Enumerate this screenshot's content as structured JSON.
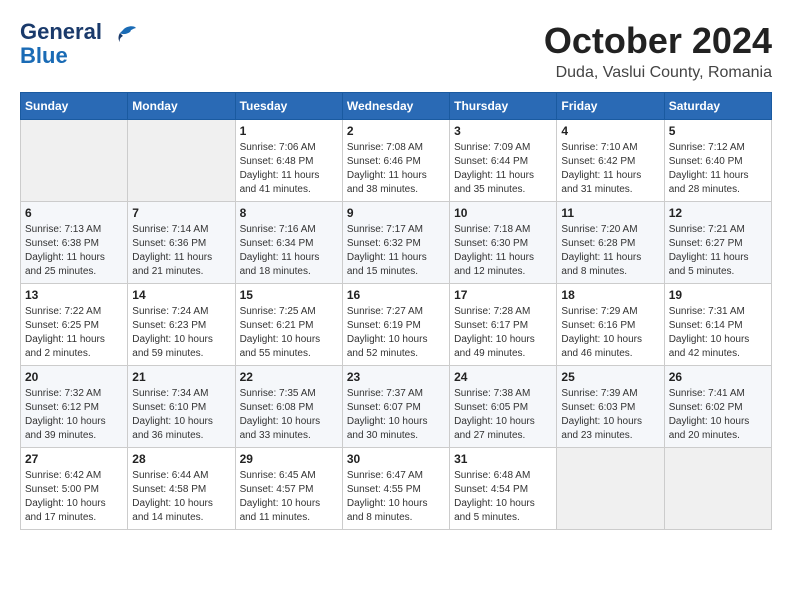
{
  "logo": {
    "line1": "General",
    "line2": "Blue"
  },
  "header": {
    "month": "October 2024",
    "location": "Duda, Vaslui County, Romania"
  },
  "weekdays": [
    "Sunday",
    "Monday",
    "Tuesday",
    "Wednesday",
    "Thursday",
    "Friday",
    "Saturday"
  ],
  "weeks": [
    [
      {
        "day": "",
        "info": ""
      },
      {
        "day": "",
        "info": ""
      },
      {
        "day": "1",
        "info": "Sunrise: 7:06 AM\nSunset: 6:48 PM\nDaylight: 11 hours and 41 minutes."
      },
      {
        "day": "2",
        "info": "Sunrise: 7:08 AM\nSunset: 6:46 PM\nDaylight: 11 hours and 38 minutes."
      },
      {
        "day": "3",
        "info": "Sunrise: 7:09 AM\nSunset: 6:44 PM\nDaylight: 11 hours and 35 minutes."
      },
      {
        "day": "4",
        "info": "Sunrise: 7:10 AM\nSunset: 6:42 PM\nDaylight: 11 hours and 31 minutes."
      },
      {
        "day": "5",
        "info": "Sunrise: 7:12 AM\nSunset: 6:40 PM\nDaylight: 11 hours and 28 minutes."
      }
    ],
    [
      {
        "day": "6",
        "info": "Sunrise: 7:13 AM\nSunset: 6:38 PM\nDaylight: 11 hours and 25 minutes."
      },
      {
        "day": "7",
        "info": "Sunrise: 7:14 AM\nSunset: 6:36 PM\nDaylight: 11 hours and 21 minutes."
      },
      {
        "day": "8",
        "info": "Sunrise: 7:16 AM\nSunset: 6:34 PM\nDaylight: 11 hours and 18 minutes."
      },
      {
        "day": "9",
        "info": "Sunrise: 7:17 AM\nSunset: 6:32 PM\nDaylight: 11 hours and 15 minutes."
      },
      {
        "day": "10",
        "info": "Sunrise: 7:18 AM\nSunset: 6:30 PM\nDaylight: 11 hours and 12 minutes."
      },
      {
        "day": "11",
        "info": "Sunrise: 7:20 AM\nSunset: 6:28 PM\nDaylight: 11 hours and 8 minutes."
      },
      {
        "day": "12",
        "info": "Sunrise: 7:21 AM\nSunset: 6:27 PM\nDaylight: 11 hours and 5 minutes."
      }
    ],
    [
      {
        "day": "13",
        "info": "Sunrise: 7:22 AM\nSunset: 6:25 PM\nDaylight: 11 hours and 2 minutes."
      },
      {
        "day": "14",
        "info": "Sunrise: 7:24 AM\nSunset: 6:23 PM\nDaylight: 10 hours and 59 minutes."
      },
      {
        "day": "15",
        "info": "Sunrise: 7:25 AM\nSunset: 6:21 PM\nDaylight: 10 hours and 55 minutes."
      },
      {
        "day": "16",
        "info": "Sunrise: 7:27 AM\nSunset: 6:19 PM\nDaylight: 10 hours and 52 minutes."
      },
      {
        "day": "17",
        "info": "Sunrise: 7:28 AM\nSunset: 6:17 PM\nDaylight: 10 hours and 49 minutes."
      },
      {
        "day": "18",
        "info": "Sunrise: 7:29 AM\nSunset: 6:16 PM\nDaylight: 10 hours and 46 minutes."
      },
      {
        "day": "19",
        "info": "Sunrise: 7:31 AM\nSunset: 6:14 PM\nDaylight: 10 hours and 42 minutes."
      }
    ],
    [
      {
        "day": "20",
        "info": "Sunrise: 7:32 AM\nSunset: 6:12 PM\nDaylight: 10 hours and 39 minutes."
      },
      {
        "day": "21",
        "info": "Sunrise: 7:34 AM\nSunset: 6:10 PM\nDaylight: 10 hours and 36 minutes."
      },
      {
        "day": "22",
        "info": "Sunrise: 7:35 AM\nSunset: 6:08 PM\nDaylight: 10 hours and 33 minutes."
      },
      {
        "day": "23",
        "info": "Sunrise: 7:37 AM\nSunset: 6:07 PM\nDaylight: 10 hours and 30 minutes."
      },
      {
        "day": "24",
        "info": "Sunrise: 7:38 AM\nSunset: 6:05 PM\nDaylight: 10 hours and 27 minutes."
      },
      {
        "day": "25",
        "info": "Sunrise: 7:39 AM\nSunset: 6:03 PM\nDaylight: 10 hours and 23 minutes."
      },
      {
        "day": "26",
        "info": "Sunrise: 7:41 AM\nSunset: 6:02 PM\nDaylight: 10 hours and 20 minutes."
      }
    ],
    [
      {
        "day": "27",
        "info": "Sunrise: 6:42 AM\nSunset: 5:00 PM\nDaylight: 10 hours and 17 minutes."
      },
      {
        "day": "28",
        "info": "Sunrise: 6:44 AM\nSunset: 4:58 PM\nDaylight: 10 hours and 14 minutes."
      },
      {
        "day": "29",
        "info": "Sunrise: 6:45 AM\nSunset: 4:57 PM\nDaylight: 10 hours and 11 minutes."
      },
      {
        "day": "30",
        "info": "Sunrise: 6:47 AM\nSunset: 4:55 PM\nDaylight: 10 hours and 8 minutes."
      },
      {
        "day": "31",
        "info": "Sunrise: 6:48 AM\nSunset: 4:54 PM\nDaylight: 10 hours and 5 minutes."
      },
      {
        "day": "",
        "info": ""
      },
      {
        "day": "",
        "info": ""
      }
    ]
  ]
}
